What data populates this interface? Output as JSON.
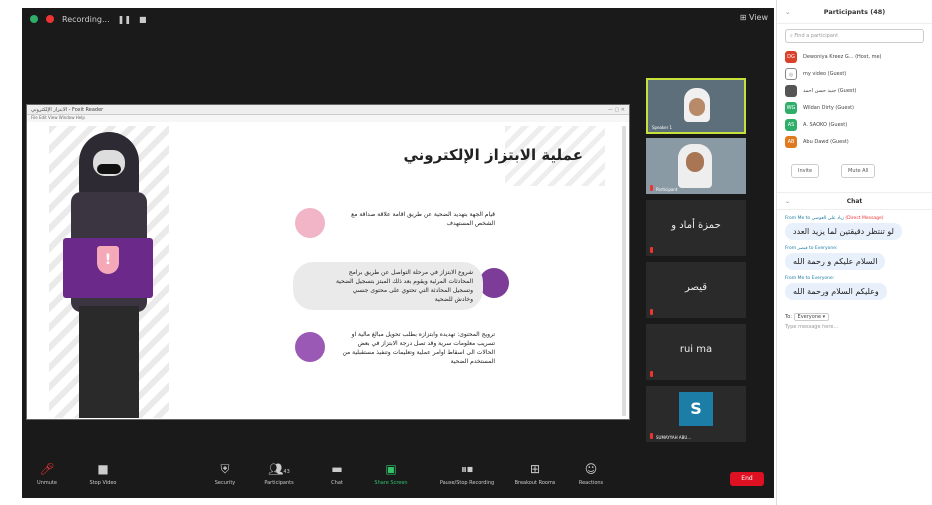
{
  "topbar": {
    "recording": "Recording...",
    "view": "View"
  },
  "share": {
    "window_title": "الابتزاز الإلكتروني - Foxit Reader",
    "menu": "File  Edit  View  Window  Help",
    "slide_title": "عملية الابتزاز الإلكتروني",
    "bullets": [
      "قيام الجهة بتهديد الضحية عن طريق اقامة علاقة صداقة مع الشخص المستهدف",
      "شروع الابتزاز في مرحلة التواصل عن طريق برامج المحادثات المرئية ويقوم بعد ذلك المبتز بتسجيل الضحية وتسجيل المحادثة التي تحتوي على محتوى جنسي وخادش للضحية",
      "ترويج المحتوى: تهديده وابتزازه بطلب تحويل مبالغ مالية او تسريب معلومات سرية وقد تصل درجة الابتزاز في بعض الحالات الى اسقاط اوامر عملية وتعليمات وتنفيذ مستقبلية من المستخدم الضحية"
    ]
  },
  "tiles": [
    {
      "name": "Speaker 1",
      "type": "video"
    },
    {
      "name": "Participant",
      "type": "video"
    },
    {
      "name": "",
      "label": "حمزة أماد و",
      "type": "name"
    },
    {
      "name": "",
      "label": "قيصر",
      "type": "name"
    },
    {
      "name": "",
      "label": "rui ma",
      "type": "name"
    },
    {
      "name": "SUMAYYAH ABU...",
      "label": "S",
      "type": "avatar"
    }
  ],
  "toolbar": {
    "unmute": "Unmute",
    "stop_video": "Stop Video",
    "security": "Security",
    "participants": "Participants",
    "participants_count": "43",
    "chat": "Chat",
    "share_screen": "Share Screen",
    "pause_share": "Pause/Stop Recording",
    "breakout": "Breakout Rooms",
    "reactions": "Reactions",
    "end": "End"
  },
  "panel": {
    "title": "Participants (48)",
    "search_placeholder": "Find a participant",
    "participants": [
      {
        "initials": "DG",
        "name": "Dewoniya Kreez G... (Host, me)",
        "color": "#d9412b"
      },
      {
        "initials": "",
        "name": "my video (Guest)",
        "color": "#888888"
      },
      {
        "initials": "",
        "name": "جنيد حسن احمد (Guest)",
        "color": "#555555"
      },
      {
        "initials": "WG",
        "name": "Wildan Dirty (Guest)",
        "color": "#2fae6a"
      },
      {
        "initials": "AS",
        "name": "A. SAOKO (Guest)",
        "color": "#2fae6a"
      },
      {
        "initials": "AB",
        "name": "Abu Dawd (Guest)",
        "color": "#e07a1f"
      }
    ],
    "invite": "Invite",
    "mute_all": "Mute All",
    "chat_title": "Chat",
    "messages": [
      {
        "from": "From Me to زياد علي العوضي",
        "tag": "(Direct Message)",
        "text": "لو تنتظر دقيقتين لما يزيد العدد"
      },
      {
        "from": "From قيصر to Everyone:",
        "tag": "",
        "text": "السلام عليكم و رحمة الله"
      },
      {
        "from": "From Me to Everyone:",
        "tag": "",
        "text": "وعليكم السلام ورحمة الله"
      }
    ],
    "to_label": "To:",
    "to_value": "Everyone",
    "type_placeholder": "Type message here..."
  }
}
